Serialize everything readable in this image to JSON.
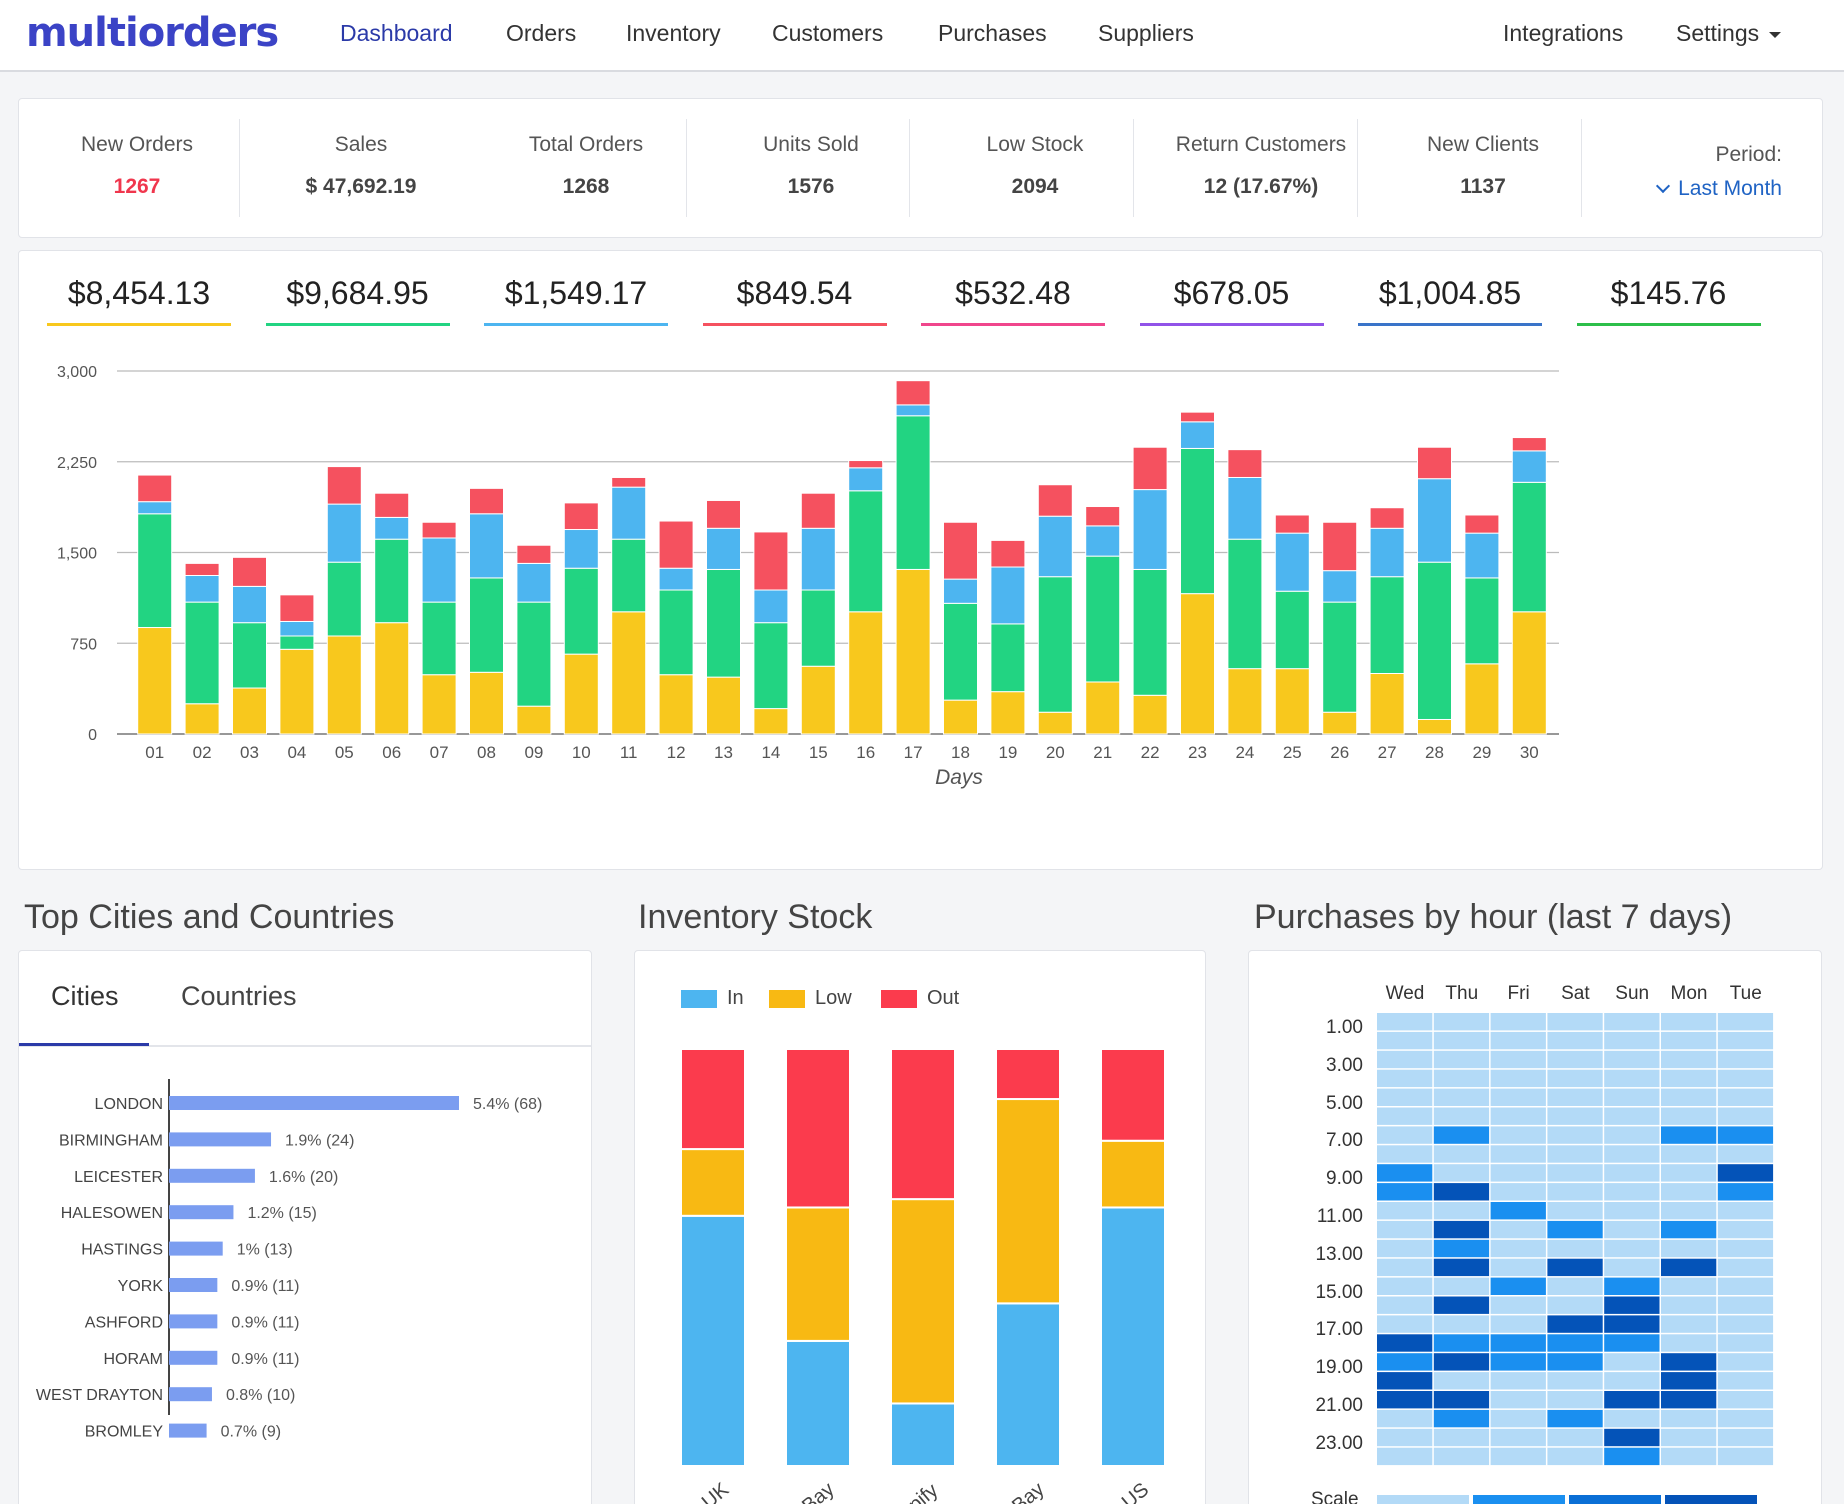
{
  "app": {
    "logo": "multiorders"
  },
  "nav": {
    "items": [
      "Dashboard",
      "Orders",
      "Inventory",
      "Customers",
      "Purchases",
      "Suppliers"
    ],
    "active": "Dashboard",
    "right": [
      "Integrations",
      "Settings"
    ]
  },
  "stats": [
    {
      "label": "New Orders",
      "value": "1267",
      "highlight": true
    },
    {
      "label": "Sales",
      "value": "$ 47,692.19"
    },
    {
      "label": "Total Orders",
      "value": "1268"
    },
    {
      "label": "Units Sold",
      "value": "1576"
    },
    {
      "label": "Low Stock",
      "value": "2094"
    },
    {
      "label": "Return Customers",
      "value": "12 (17.67%)"
    },
    {
      "label": "New Clients",
      "value": "1137"
    }
  ],
  "period": {
    "label": "Period:",
    "value": "Last Month"
  },
  "totals": [
    {
      "value": "$8,454.13",
      "color": "#f8c81d"
    },
    {
      "value": "$9,684.95",
      "color": "#22d482"
    },
    {
      "value": "$1,549.17",
      "color": "#4db5f0"
    },
    {
      "value": "$849.54",
      "color": "#f5515f"
    },
    {
      "value": "$532.48",
      "color": "#f0468c"
    },
    {
      "value": "$678.05",
      "color": "#9153e8"
    },
    {
      "value": "$1,004.85",
      "color": "#3a74c9"
    },
    {
      "value": "$145.76",
      "color": "#2dbf4a"
    }
  ],
  "chart_data": [
    {
      "type": "bar",
      "stacked": true,
      "xlabel": "Days",
      "ylabel": "",
      "ylim": [
        0,
        3000
      ],
      "yticks": [
        "0",
        "750",
        "1,500",
        "2,250",
        "3,000"
      ],
      "grid": true,
      "categories": [
        "01",
        "02",
        "03",
        "04",
        "05",
        "06",
        "07",
        "08",
        "09",
        "10",
        "11",
        "12",
        "13",
        "14",
        "15",
        "16",
        "17",
        "18",
        "19",
        "20",
        "21",
        "22",
        "23",
        "24",
        "25",
        "26",
        "27",
        "28",
        "29",
        "30"
      ],
      "series": [
        {
          "color": "#f8c81d",
          "values": [
            880,
            250,
            380,
            700,
            810,
            920,
            490,
            510,
            230,
            660,
            1010,
            490,
            470,
            210,
            560,
            1010,
            1360,
            280,
            350,
            180,
            430,
            320,
            1160,
            540,
            540,
            180,
            500,
            120,
            580,
            1010
          ]
        },
        {
          "color": "#22d482",
          "values": [
            940,
            840,
            540,
            110,
            610,
            690,
            600,
            780,
            860,
            710,
            600,
            700,
            890,
            710,
            630,
            1000,
            1270,
            800,
            560,
            1120,
            1040,
            1040,
            1200,
            1070,
            640,
            910,
            800,
            1300,
            710,
            1070
          ]
        },
        {
          "color": "#4db5f0",
          "values": [
            100,
            220,
            300,
            120,
            480,
            180,
            530,
            530,
            320,
            320,
            430,
            180,
            340,
            270,
            510,
            190,
            90,
            200,
            470,
            500,
            250,
            660,
            220,
            510,
            480,
            260,
            400,
            690,
            370,
            260
          ]
        },
        {
          "color": "#f5515f",
          "values": [
            220,
            100,
            240,
            220,
            310,
            200,
            130,
            210,
            150,
            220,
            80,
            390,
            230,
            480,
            290,
            60,
            200,
            470,
            220,
            260,
            160,
            350,
            80,
            230,
            150,
            400,
            170,
            260,
            150,
            110
          ]
        }
      ]
    },
    {
      "type": "bar",
      "title": "Top Cities and Countries",
      "orientation": "horizontal",
      "categories": [
        "LONDON",
        "BIRMINGHAM",
        "LEICESTER",
        "HALESOWEN",
        "HASTINGS",
        "YORK",
        "ASHFORD",
        "HORAM",
        "WEST DRAYTON",
        "BROMLEY"
      ],
      "values": [
        5.4,
        1.9,
        1.6,
        1.2,
        1.0,
        0.9,
        0.9,
        0.9,
        0.8,
        0.7
      ],
      "labels": [
        "5.4% (68)",
        "1.9% (24)",
        "1.6% (20)",
        "1.2% (15)",
        "1% (13)",
        "0.9% (11)",
        "0.9% (11)",
        "0.9% (11)",
        "0.8% (10)",
        "0.7% (9)"
      ],
      "color": "#7b9df0"
    },
    {
      "type": "bar",
      "title": "Inventory Stock",
      "stacked": true,
      "normalized": true,
      "categories": [
        "n UK",
        "eBay",
        "opify",
        "eBay",
        "n US"
      ],
      "series": [
        {
          "name": "In",
          "color": "#4db5f0",
          "values": [
            0.6,
            0.3,
            0.15,
            0.39,
            0.62
          ]
        },
        {
          "name": "Low",
          "color": "#f8b913",
          "values": [
            0.16,
            0.32,
            0.49,
            0.49,
            0.16
          ]
        },
        {
          "name": "Out",
          "color": "#fb3b4d",
          "values": [
            0.24,
            0.38,
            0.36,
            0.12,
            0.22
          ]
        }
      ]
    },
    {
      "type": "heatmap",
      "title": "Purchases by hour (last 7 days)",
      "x": [
        "Wed",
        "Thu",
        "Fri",
        "Sat",
        "Sun",
        "Mon",
        "Tue"
      ],
      "y": [
        "1.00",
        "2.00",
        "3.00",
        "4.00",
        "5.00",
        "6.00",
        "7.00",
        "8.00",
        "9.00",
        "10.00",
        "11.00",
        "12.00",
        "13.00",
        "14.00",
        "15.00",
        "16.00",
        "17.00",
        "18.00",
        "19.00",
        "20.00",
        "21.00",
        "22.00",
        "23.00",
        "24.00"
      ],
      "y_tick_labels": [
        "1.00",
        "3.00",
        "5.00",
        "7.00",
        "9.00",
        "11.00",
        "13.00",
        "15.00",
        "17.00",
        "19.00",
        "21.00",
        "23.00"
      ],
      "scale_label": "Scale",
      "levels": [
        "#b3daf7",
        "#1a8ff0",
        "#0a6fd6",
        "#0453b8"
      ],
      "values": [
        [
          0,
          0,
          0,
          0,
          0,
          0,
          0
        ],
        [
          0,
          0,
          0,
          0,
          0,
          0,
          0
        ],
        [
          0,
          0,
          0,
          0,
          0,
          0,
          0
        ],
        [
          0,
          0,
          0,
          0,
          0,
          0,
          0
        ],
        [
          0,
          0,
          0,
          0,
          0,
          0,
          0
        ],
        [
          0,
          0,
          0,
          0,
          0,
          0,
          0
        ],
        [
          0,
          1,
          0,
          0,
          0,
          1,
          1
        ],
        [
          0,
          0,
          0,
          0,
          0,
          0,
          0
        ],
        [
          1,
          0,
          0,
          0,
          0,
          0,
          3
        ],
        [
          1,
          3,
          0,
          0,
          0,
          0,
          1
        ],
        [
          0,
          0,
          1,
          0,
          0,
          0,
          0
        ],
        [
          0,
          3,
          0,
          1,
          0,
          1,
          0
        ],
        [
          0,
          1,
          0,
          0,
          0,
          0,
          0
        ],
        [
          0,
          3,
          0,
          3,
          0,
          3,
          0
        ],
        [
          0,
          0,
          1,
          0,
          1,
          0,
          0
        ],
        [
          0,
          3,
          0,
          0,
          3,
          0,
          0
        ],
        [
          0,
          0,
          0,
          3,
          3,
          0,
          0
        ],
        [
          3,
          1,
          1,
          1,
          1,
          0,
          0
        ],
        [
          1,
          3,
          1,
          1,
          0,
          3,
          0
        ],
        [
          3,
          0,
          0,
          0,
          0,
          3,
          0
        ],
        [
          3,
          3,
          0,
          0,
          3,
          3,
          0
        ],
        [
          0,
          1,
          0,
          1,
          0,
          0,
          0
        ],
        [
          0,
          0,
          0,
          0,
          3,
          0,
          0
        ],
        [
          0,
          0,
          0,
          0,
          1,
          0,
          0
        ]
      ]
    }
  ],
  "sections": {
    "cities_title": "Top Cities and Countries",
    "inventory_title": "Inventory Stock",
    "purchases_title": "Purchases by hour (last 7 days)"
  },
  "tabs": {
    "cities": "Cities",
    "countries": "Countries"
  }
}
